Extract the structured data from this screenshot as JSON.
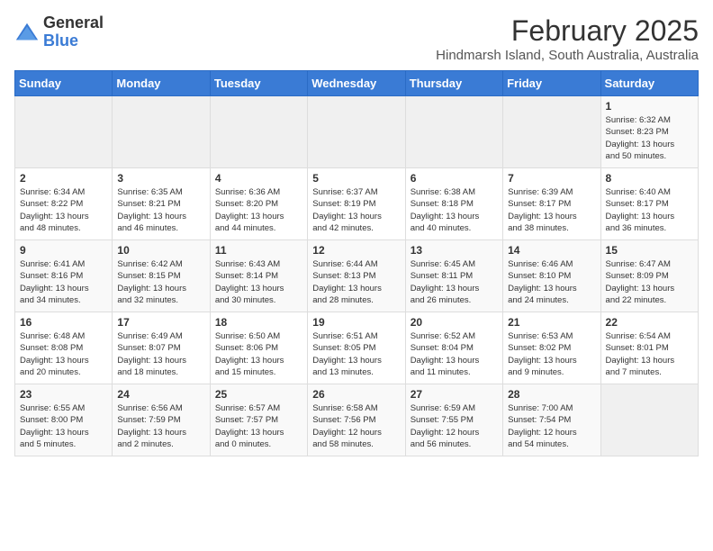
{
  "header": {
    "logo_general": "General",
    "logo_blue": "Blue",
    "month": "February 2025",
    "location": "Hindmarsh Island, South Australia, Australia"
  },
  "weekdays": [
    "Sunday",
    "Monday",
    "Tuesday",
    "Wednesday",
    "Thursday",
    "Friday",
    "Saturday"
  ],
  "weeks": [
    [
      {
        "day": "",
        "info": ""
      },
      {
        "day": "",
        "info": ""
      },
      {
        "day": "",
        "info": ""
      },
      {
        "day": "",
        "info": ""
      },
      {
        "day": "",
        "info": ""
      },
      {
        "day": "",
        "info": ""
      },
      {
        "day": "1",
        "info": "Sunrise: 6:32 AM\nSunset: 8:23 PM\nDaylight: 13 hours\nand 50 minutes."
      }
    ],
    [
      {
        "day": "2",
        "info": "Sunrise: 6:34 AM\nSunset: 8:22 PM\nDaylight: 13 hours\nand 48 minutes."
      },
      {
        "day": "3",
        "info": "Sunrise: 6:35 AM\nSunset: 8:21 PM\nDaylight: 13 hours\nand 46 minutes."
      },
      {
        "day": "4",
        "info": "Sunrise: 6:36 AM\nSunset: 8:20 PM\nDaylight: 13 hours\nand 44 minutes."
      },
      {
        "day": "5",
        "info": "Sunrise: 6:37 AM\nSunset: 8:19 PM\nDaylight: 13 hours\nand 42 minutes."
      },
      {
        "day": "6",
        "info": "Sunrise: 6:38 AM\nSunset: 8:18 PM\nDaylight: 13 hours\nand 40 minutes."
      },
      {
        "day": "7",
        "info": "Sunrise: 6:39 AM\nSunset: 8:17 PM\nDaylight: 13 hours\nand 38 minutes."
      },
      {
        "day": "8",
        "info": "Sunrise: 6:40 AM\nSunset: 8:17 PM\nDaylight: 13 hours\nand 36 minutes."
      }
    ],
    [
      {
        "day": "9",
        "info": "Sunrise: 6:41 AM\nSunset: 8:16 PM\nDaylight: 13 hours\nand 34 minutes."
      },
      {
        "day": "10",
        "info": "Sunrise: 6:42 AM\nSunset: 8:15 PM\nDaylight: 13 hours\nand 32 minutes."
      },
      {
        "day": "11",
        "info": "Sunrise: 6:43 AM\nSunset: 8:14 PM\nDaylight: 13 hours\nand 30 minutes."
      },
      {
        "day": "12",
        "info": "Sunrise: 6:44 AM\nSunset: 8:13 PM\nDaylight: 13 hours\nand 28 minutes."
      },
      {
        "day": "13",
        "info": "Sunrise: 6:45 AM\nSunset: 8:11 PM\nDaylight: 13 hours\nand 26 minutes."
      },
      {
        "day": "14",
        "info": "Sunrise: 6:46 AM\nSunset: 8:10 PM\nDaylight: 13 hours\nand 24 minutes."
      },
      {
        "day": "15",
        "info": "Sunrise: 6:47 AM\nSunset: 8:09 PM\nDaylight: 13 hours\nand 22 minutes."
      }
    ],
    [
      {
        "day": "16",
        "info": "Sunrise: 6:48 AM\nSunset: 8:08 PM\nDaylight: 13 hours\nand 20 minutes."
      },
      {
        "day": "17",
        "info": "Sunrise: 6:49 AM\nSunset: 8:07 PM\nDaylight: 13 hours\nand 18 minutes."
      },
      {
        "day": "18",
        "info": "Sunrise: 6:50 AM\nSunset: 8:06 PM\nDaylight: 13 hours\nand 15 minutes."
      },
      {
        "day": "19",
        "info": "Sunrise: 6:51 AM\nSunset: 8:05 PM\nDaylight: 13 hours\nand 13 minutes."
      },
      {
        "day": "20",
        "info": "Sunrise: 6:52 AM\nSunset: 8:04 PM\nDaylight: 13 hours\nand 11 minutes."
      },
      {
        "day": "21",
        "info": "Sunrise: 6:53 AM\nSunset: 8:02 PM\nDaylight: 13 hours\nand 9 minutes."
      },
      {
        "day": "22",
        "info": "Sunrise: 6:54 AM\nSunset: 8:01 PM\nDaylight: 13 hours\nand 7 minutes."
      }
    ],
    [
      {
        "day": "23",
        "info": "Sunrise: 6:55 AM\nSunset: 8:00 PM\nDaylight: 13 hours\nand 5 minutes."
      },
      {
        "day": "24",
        "info": "Sunrise: 6:56 AM\nSunset: 7:59 PM\nDaylight: 13 hours\nand 2 minutes."
      },
      {
        "day": "25",
        "info": "Sunrise: 6:57 AM\nSunset: 7:57 PM\nDaylight: 13 hours\nand 0 minutes."
      },
      {
        "day": "26",
        "info": "Sunrise: 6:58 AM\nSunset: 7:56 PM\nDaylight: 12 hours\nand 58 minutes."
      },
      {
        "day": "27",
        "info": "Sunrise: 6:59 AM\nSunset: 7:55 PM\nDaylight: 12 hours\nand 56 minutes."
      },
      {
        "day": "28",
        "info": "Sunrise: 7:00 AM\nSunset: 7:54 PM\nDaylight: 12 hours\nand 54 minutes."
      },
      {
        "day": "",
        "info": ""
      }
    ]
  ]
}
